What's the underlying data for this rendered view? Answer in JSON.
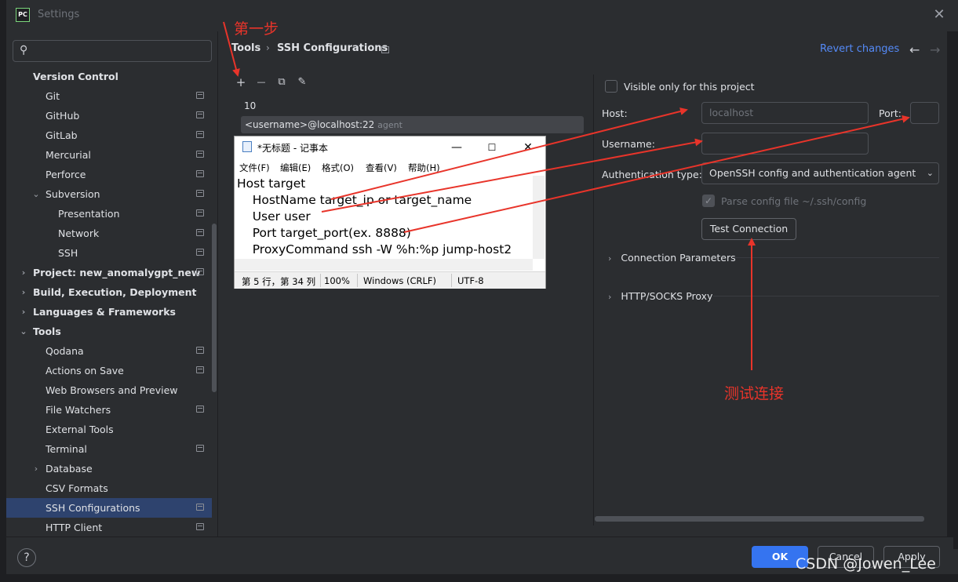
{
  "window": {
    "title": "Settings"
  },
  "search": {
    "placeholder": ""
  },
  "sidebar": {
    "items": [
      {
        "label": "Version Control",
        "level": 0,
        "bold": true,
        "expand": "",
        "icon": false
      },
      {
        "label": "Git",
        "level": 1,
        "bold": false,
        "expand": "",
        "icon": true
      },
      {
        "label": "GitHub",
        "level": 1,
        "bold": false,
        "expand": "",
        "icon": true
      },
      {
        "label": "GitLab",
        "level": 1,
        "bold": false,
        "expand": "",
        "icon": true
      },
      {
        "label": "Mercurial",
        "level": 1,
        "bold": false,
        "expand": "",
        "icon": true
      },
      {
        "label": "Perforce",
        "level": 1,
        "bold": false,
        "expand": "",
        "icon": true
      },
      {
        "label": "Subversion",
        "level": 1,
        "bold": false,
        "expand": "down",
        "icon": true
      },
      {
        "label": "Presentation",
        "level": 2,
        "bold": false,
        "expand": "",
        "icon": true
      },
      {
        "label": "Network",
        "level": 2,
        "bold": false,
        "expand": "",
        "icon": true
      },
      {
        "label": "SSH",
        "level": 2,
        "bold": false,
        "expand": "",
        "icon": true
      },
      {
        "label": "Project: new_anomalygpt_new",
        "level": 0,
        "bold": true,
        "expand": "right",
        "icon": true
      },
      {
        "label": "Build, Execution, Deployment",
        "level": 0,
        "bold": true,
        "expand": "right",
        "icon": false
      },
      {
        "label": "Languages & Frameworks",
        "level": 0,
        "bold": true,
        "expand": "right",
        "icon": false
      },
      {
        "label": "Tools",
        "level": 0,
        "bold": true,
        "expand": "down",
        "icon": false
      },
      {
        "label": "Qodana",
        "level": 1,
        "bold": false,
        "expand": "",
        "icon": true
      },
      {
        "label": "Actions on Save",
        "level": 1,
        "bold": false,
        "expand": "",
        "icon": true
      },
      {
        "label": "Web Browsers and Preview",
        "level": 1,
        "bold": false,
        "expand": "",
        "icon": false
      },
      {
        "label": "File Watchers",
        "level": 1,
        "bold": false,
        "expand": "",
        "icon": true
      },
      {
        "label": "External Tools",
        "level": 1,
        "bold": false,
        "expand": "",
        "icon": false
      },
      {
        "label": "Terminal",
        "level": 1,
        "bold": false,
        "expand": "",
        "icon": true
      },
      {
        "label": "Database",
        "level": 1,
        "bold": false,
        "expand": "right",
        "icon": false
      },
      {
        "label": "CSV Formats",
        "level": 1,
        "bold": false,
        "expand": "",
        "icon": false
      },
      {
        "label": "SSH Configurations",
        "level": 1,
        "bold": false,
        "expand": "",
        "icon": true,
        "selected": true
      },
      {
        "label": "HTTP Client",
        "level": 1,
        "bold": false,
        "expand": "",
        "icon": true
      }
    ]
  },
  "breadcrumb": {
    "parent": "Tools",
    "current": "SSH Configurations"
  },
  "header": {
    "revert_label": "Revert changes",
    "back_icon": "←",
    "forward_icon": "→"
  },
  "toolbar": {
    "add": "+",
    "remove": "—",
    "copy": "⧉",
    "edit": "✎"
  },
  "ssh_list": {
    "count": "10",
    "entry": "<username>@localhost:22",
    "entry_tag": "agent"
  },
  "config": {
    "visible_label": "Visible only for this project",
    "host_label": "Host:",
    "host_placeholder": "localhost",
    "port_label": "Port:",
    "username_label": "Username:",
    "auth_label": "Authentication type:",
    "auth_value": "OpenSSH config and authentication agent",
    "parse_label": "Parse config file ~/.ssh/config",
    "test_label": "Test Connection",
    "section_conn": "Connection Parameters",
    "section_proxy": "HTTP/SOCKS Proxy"
  },
  "footer": {
    "help": "?",
    "ok": "OK",
    "cancel": "Cancel",
    "apply": "Apply"
  },
  "notepad": {
    "title": "*无标题 - 记事本",
    "menu": [
      "文件(F)",
      "编辑(E)",
      "格式(O)",
      "查看(V)",
      "帮助(H)"
    ],
    "lines": [
      "Host target",
      "    HostName target_ip or target_name",
      "    User user",
      "    Port target_port(ex. 8888)",
      "    ProxyCommand ssh -W %h:%p jump-host2"
    ],
    "status_pos": "第 5 行，第 34 列",
    "status_zoom": "100%",
    "status_eol": "Windows (CRLF)",
    "status_enc": "UTF-8"
  },
  "annotations": {
    "step1": "第一步",
    "test": "测试连接"
  },
  "watermark": "CSDN @Jowen_Lee",
  "colors": {
    "accent": "#3574f0",
    "link": "#548af7",
    "annotation": "#e8342a",
    "selection": "#2e436e"
  }
}
